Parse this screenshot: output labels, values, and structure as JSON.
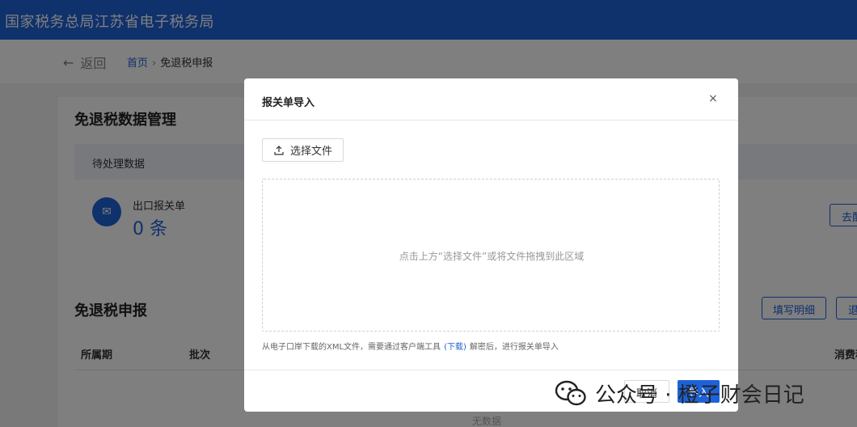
{
  "header": {
    "title": "国家税务总局江苏省电子税务局"
  },
  "subnav": {
    "back_label": "返回",
    "breadcrumb_home": "首页",
    "breadcrumb_sep": "›",
    "breadcrumb_current": "免退税申报"
  },
  "page": {
    "section1_title": "免退税数据管理",
    "pending_header": "待处理数据",
    "stat_label": "出口报关单",
    "stat_value": "0 条",
    "go_button": "去配",
    "section2_title": "免退税申报",
    "fill_button": "填写明细",
    "return_button": "退",
    "table_headers": [
      "所属期",
      "批次",
      "消费税"
    ],
    "empty_text": "无数据"
  },
  "modal": {
    "title": "报关单导入",
    "close_symbol": "×",
    "choose_file_label": "选择文件",
    "dropzone_text": "点击上方“选择文件”或将文件拖拽到此区域",
    "tip_before": "从电子口岸下载的XML文件，需要通过客户端工具",
    "tip_link": "(下载)",
    "tip_after": "解密后，进行报关单导入",
    "cancel_label": "取消",
    "import_label": "导入"
  },
  "watermark": {
    "text": "公众号 · 橙子财会日记",
    "icon": "wechat-icon"
  },
  "colors": {
    "brand": "#1e62d8",
    "mask": "rgba(0,0,0,0.5)"
  }
}
